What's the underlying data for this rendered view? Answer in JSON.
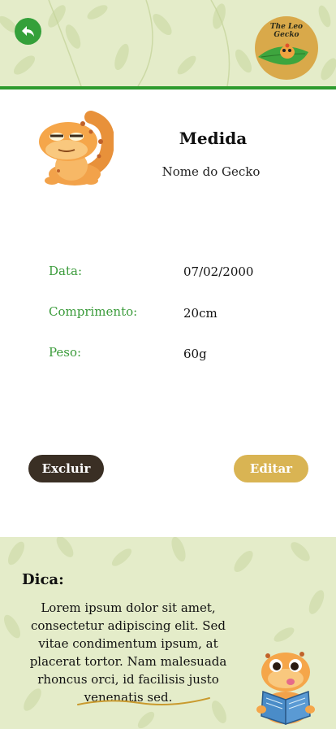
{
  "header": {
    "back_icon": "back-arrow-icon",
    "logo_text_line1": "The Leo",
    "logo_text_line2": "Gecko",
    "colors": {
      "accent": "#34a03a",
      "header_bg": "#e4ecc9",
      "divider": "#2e9b2e"
    }
  },
  "card": {
    "title": "Medida",
    "gecko_name": "Nome do Gecko",
    "rows": [
      {
        "label": "Data:",
        "value": "07/02/2000"
      },
      {
        "label": "Comprimento:",
        "value": "20cm"
      },
      {
        "label": "Peso:",
        "value": "60g"
      }
    ]
  },
  "actions": {
    "delete_label": "Excluir",
    "edit_label": "Editar",
    "delete_color": "#3a2f24",
    "edit_color": "#d9b453"
  },
  "tip": {
    "title": "Dica:",
    "text": "Lorem ipsum dolor sit amet, consectetur adipiscing elit. Sed vitae condimentum ipsum, at placerat tortor. Nam malesuada rhoncus orci, id facilisis justo venenatis sed."
  }
}
